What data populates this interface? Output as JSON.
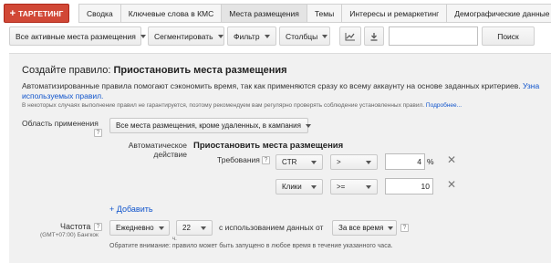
{
  "header": {
    "target_button": "ТАРГЕТИНГ",
    "tabs": [
      "Сводка",
      "Ключевые слова в КМС",
      "Места размещения",
      "Темы",
      "Интересы и ремаркетинг",
      "Демографические данные"
    ],
    "active_tab_index": 2
  },
  "toolbar": {
    "filter_all": "Все активные места размещения",
    "segment": "Сегментировать",
    "filter": "Фильтр",
    "columns": "Столбцы",
    "search_value": "",
    "search_button": "Поиск"
  },
  "rule": {
    "title_prefix": "Создайте правило: ",
    "title_bold": "Приостановить места размещения",
    "description": "Автоматизированные правила помогают сэкономить время, так как применяются сразу ко всему аккаунту на основе заданных критериев.",
    "description_link": "Узна",
    "description_line2_link": "используемых правил.",
    "note": "В некоторых случаях выполнение правил не гарантируется, поэтому рекомендуем вам регулярно проверять соблюдение установленных правил.",
    "note_link": "Подробнее...",
    "scope_label": "Область применения",
    "scope_value": "Все места размещения, кроме удаленных, в кампания",
    "action_label_line1": "Автоматическое",
    "action_label_line2": "действие",
    "action_value": "Приостановить места размещения",
    "requirements_label": "Требования",
    "conditions": [
      {
        "metric": "CTR",
        "operator": ">",
        "value": "4",
        "unit": "%"
      },
      {
        "metric": "Клики",
        "operator": ">=",
        "value": "10",
        "unit": ""
      }
    ],
    "add_link": "+ Добавить",
    "frequency_label": "Частота",
    "timezone": "(GMT+07:00) Бангкок",
    "frequency_value": "Ежедневно",
    "hour_value": "22",
    "hour_suffix": "ч.",
    "data_label": "с использованием данных от",
    "data_range": "За все время",
    "frequency_note": "Обратите внимание: правило может быть запущено в любое время в течение указанного часа."
  }
}
